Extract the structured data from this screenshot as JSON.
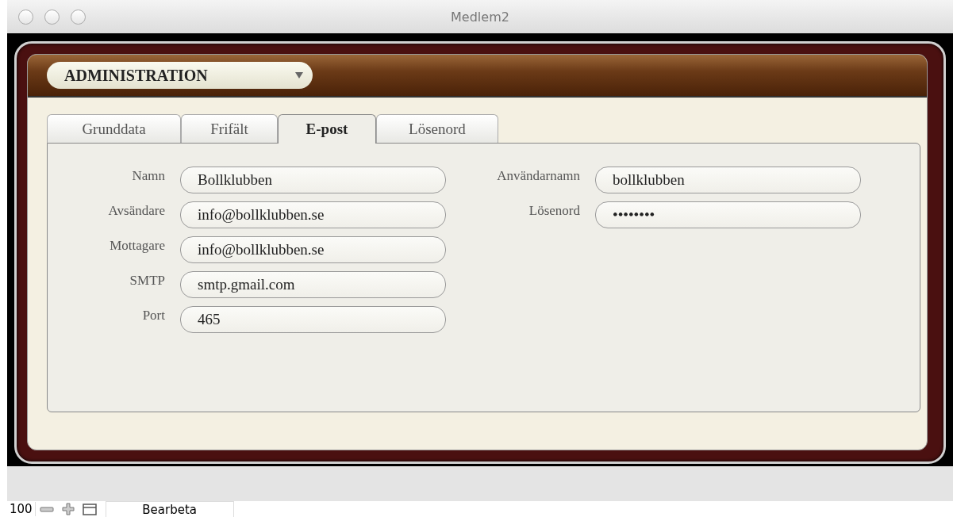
{
  "window": {
    "title": "Medlem2"
  },
  "header": {
    "menu": {
      "label": "ADMINISTRATION"
    }
  },
  "tabs": [
    {
      "label": "Grunddata",
      "selected": false
    },
    {
      "label": "Frifält",
      "selected": false
    },
    {
      "label": "E-post",
      "selected": true
    },
    {
      "label": "Lösenord",
      "selected": false
    }
  ],
  "form": {
    "left": [
      {
        "label": "Namn",
        "value": "Bollklubben"
      },
      {
        "label": "Avsändare",
        "value": "info@bollklubben.se"
      },
      {
        "label": "Mottagare",
        "value": "info@bollklubben.se"
      },
      {
        "label": "SMTP",
        "value": "smtp.gmail.com"
      },
      {
        "label": "Port",
        "value": "465"
      }
    ],
    "right": [
      {
        "label": "Användarnamn",
        "value": "bollklubben"
      },
      {
        "label": "Lösenord",
        "value": "••••••••"
      }
    ]
  },
  "status_bar": {
    "zoom": "100",
    "mode": "Bearbeta"
  }
}
